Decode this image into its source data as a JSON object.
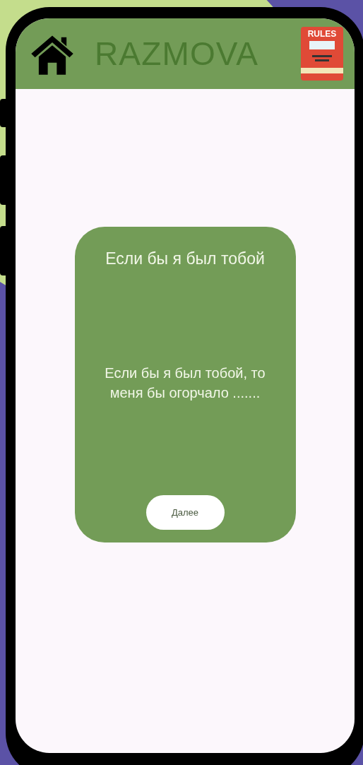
{
  "app_bar": {
    "title": "RAZMOVA",
    "rules_label": "RULES"
  },
  "card": {
    "title": "Если бы я был тобой",
    "prompt": "Если бы я был тобой, то меня бы огорчало .......",
    "next_button": "Далее"
  }
}
